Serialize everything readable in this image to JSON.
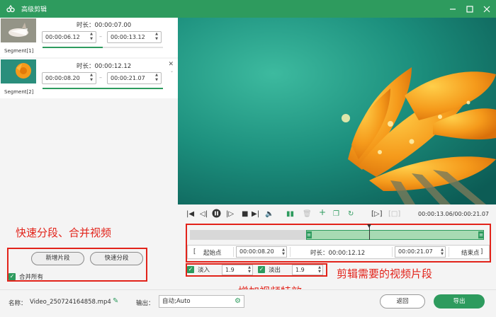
{
  "window": {
    "title": "高级剪辑",
    "logo_icon": "app-logo-icon",
    "controls": [
      "minimize-icon",
      "maximize-icon",
      "close-icon"
    ]
  },
  "segments": [
    {
      "label": "Segment[1]",
      "duration": "时长：00:00:07.00",
      "start": "00:00:06.12",
      "end": "00:00:13.12",
      "progress": 0.5
    },
    {
      "label": "Segment[2]",
      "duration": "时长：00:00:12.12",
      "start": "00:00:08.20",
      "end": "00:00:21.07",
      "progress": 1.0
    }
  ],
  "left_panel": {
    "annotation": "快速分段、合并视频",
    "add_segment": "新增片段",
    "quick_split": "快速分段",
    "merge_all": "合并所有"
  },
  "player": {
    "time": "00:00:13.06/00:00:21.07"
  },
  "trim": {
    "start_label": "起始点",
    "start_value": "00:00:08.20",
    "duration_label": "时长：00:00:12.12",
    "end_value": "00:00:21.07",
    "end_label": "结束点",
    "selection_start_fraction": 0.395,
    "selection_end_fraction": 1.0,
    "playhead_fraction": 0.61
  },
  "effects": {
    "fade_in_label": "淡入",
    "fade_in_value": "1.9",
    "fade_out_label": "淡出",
    "fade_out_value": "1.9"
  },
  "annotations": {
    "trim_note": "剪辑需要的视频片段",
    "effects_note": "增加视频特效"
  },
  "bottom": {
    "name_label": "名称：",
    "file_name": "Video_250724164858.mp4",
    "output_label": "输出：",
    "output_value": "自动;Auto",
    "back": "返回",
    "export": "导出"
  },
  "colors": {
    "accent": "#2e9b5e",
    "annotation": "#e2231a"
  }
}
